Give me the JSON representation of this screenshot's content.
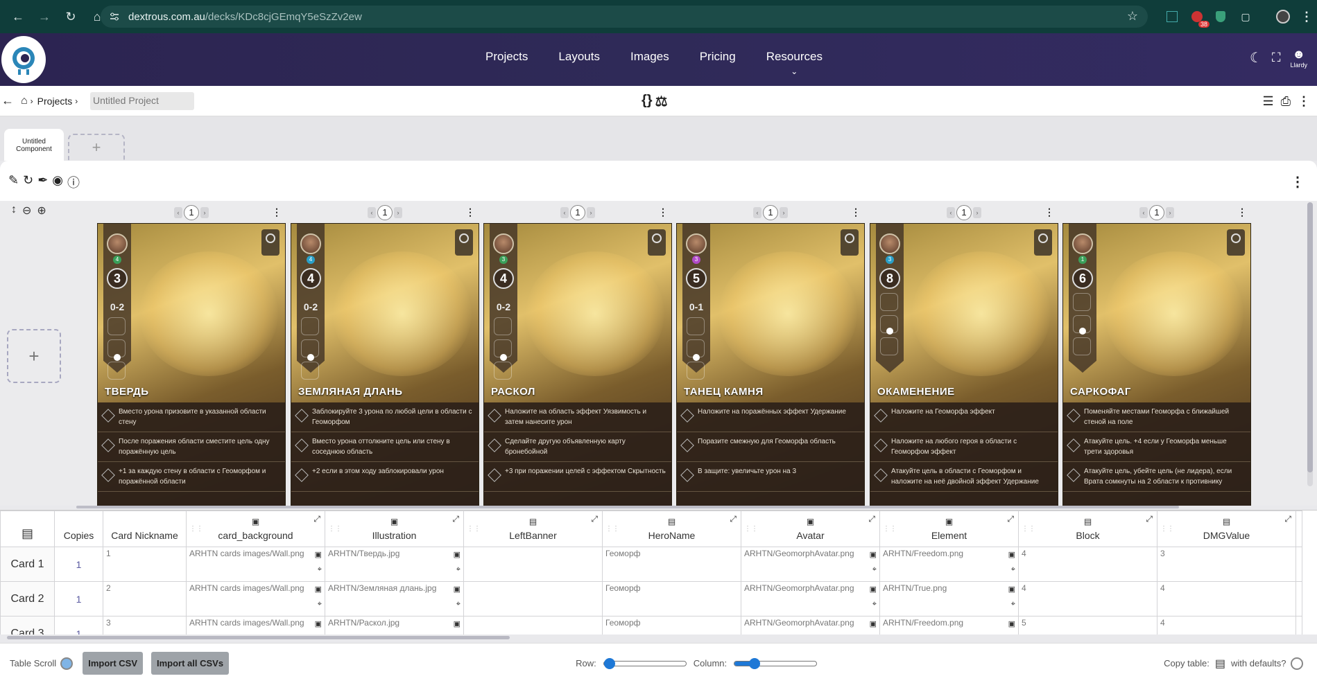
{
  "browser": {
    "url_domain": "dextrous.com.au",
    "url_path": "/decks/KDc8cjGEmqY5eSzZv2ew",
    "ext_badge": "38"
  },
  "app": {
    "nav": [
      "Projects",
      "Layouts",
      "Images",
      "Pricing",
      "Resources"
    ],
    "user_label": "Llardy"
  },
  "breadcrumb": {
    "projects": "Projects",
    "project_name": "Untitled Project"
  },
  "component_tab": "Untitled Component",
  "add_tab": "+",
  "add_card": "+",
  "cards": [
    {
      "page": "1",
      "title": "ТВЕРДЬ",
      "block": "3",
      "level": "4",
      "level_color": "#3aa05a",
      "dmg": "0-2",
      "effects": [
        "Вместо урона призовите в указанной области стену",
        "После поражения области сместите цель одну поражённую цель",
        "+1 за каждую стену в области с Геоморфом и поражённой области"
      ]
    },
    {
      "page": "1",
      "title": "ЗЕМЛЯНАЯ ДЛАНЬ",
      "block": "4",
      "level": "4",
      "level_color": "#2aa0c8",
      "dmg": "0-2",
      "effects": [
        "Заблокируйте 3 урона по любой цели в области с Геоморфом",
        "Вместо урона оттолкните цель или стену в соседнюю область",
        "+2 если в этом ходу заблокировали урон"
      ]
    },
    {
      "page": "1",
      "title": "РАСКОЛ",
      "block": "4",
      "level": "3",
      "level_color": "#3aa05a",
      "dmg": "0-2",
      "effects": [
        "Наложите на область эффект Уязвимость и затем нанесите урон",
        "Сделайте другую объявленную карту бронебойной",
        "+3 при поражении целей с эффектом Скрытность"
      ]
    },
    {
      "page": "1",
      "title": "ТАНЕЦ КАМНЯ",
      "block": "5",
      "level": "3",
      "level_color": "#b04ac8",
      "dmg": "0-1",
      "effects": [
        "Наложите на поражённых эффект Удержание",
        "Поразите смежную для Геоморфа область",
        "В защите: увеличьте урон на 3"
      ]
    },
    {
      "page": "1",
      "title": "ОКАМЕНЕНИЕ",
      "block": "8",
      "level": "3",
      "level_color": "#2aa0c8",
      "dmg": "",
      "effects": [
        "Наложите на Геоморфа эффект",
        "Наложите на любого героя в области с Геоморфом эффект",
        "Атакуйте цель в области с Геоморфом и наложите на неё двойной эффект Удержание"
      ]
    },
    {
      "page": "1",
      "title": "САРКОФАГ",
      "block": "6",
      "level": "1",
      "level_color": "#3aa05a",
      "dmg": "",
      "effects": [
        "Поменяйте местами Геоморфа с ближайшей стеной на поле",
        "Атакуйте цель. +4 если у Геоморфа меньше трети здоровья",
        "Атакуйте цель, убейте цель (не лидера), если Врата сомкнуты на 2 области к противнику"
      ]
    }
  ],
  "table": {
    "headers": [
      "Copies",
      "Card Nickname",
      "card_background",
      "Illustration",
      "LeftBanner",
      "HeroName",
      "Avatar",
      "Element",
      "Block",
      "DMGValue"
    ],
    "rows": [
      {
        "label": "Card 1",
        "copies": "1",
        "nickname": "1",
        "card_background": "ARHTN cards images/Wall.png",
        "illustration": "ARHTN/Твердь.jpg",
        "left_banner": "",
        "hero": "Геоморф",
        "avatar": "ARHTN/GeomorphAvatar.png",
        "element": "ARHTN/Freedom.png",
        "block": "4",
        "dmg": "3"
      },
      {
        "label": "Card 2",
        "copies": "1",
        "nickname": "2",
        "card_background": "ARHTN cards images/Wall.png",
        "illustration": "ARHTN/Земляная длань.jpg",
        "left_banner": "",
        "hero": "Геоморф",
        "avatar": "ARHTN/GeomorphAvatar.png",
        "element": "ARHTN/True.png",
        "block": "4",
        "dmg": "4"
      },
      {
        "label": "Card 3",
        "copies": "1",
        "nickname": "3",
        "card_background": "ARHTN cards images/Wall.png",
        "illustration": "ARHTN/Раскол.jpg",
        "left_banner": "",
        "hero": "Геоморф",
        "avatar": "ARHTN/GeomorphAvatar.png",
        "element": "ARHTN/Freedom.png",
        "block": "5",
        "dmg": "4"
      }
    ]
  },
  "bottom": {
    "table_scroll": "Table Scroll",
    "import_csv": "Import CSV",
    "import_all": "Import all CSVs",
    "row_label": "Row:",
    "column_label": "Column:",
    "copy_table": "Copy table:",
    "with_defaults": "with defaults?",
    "row_slider": 0.0,
    "column_slider": 0.2
  }
}
